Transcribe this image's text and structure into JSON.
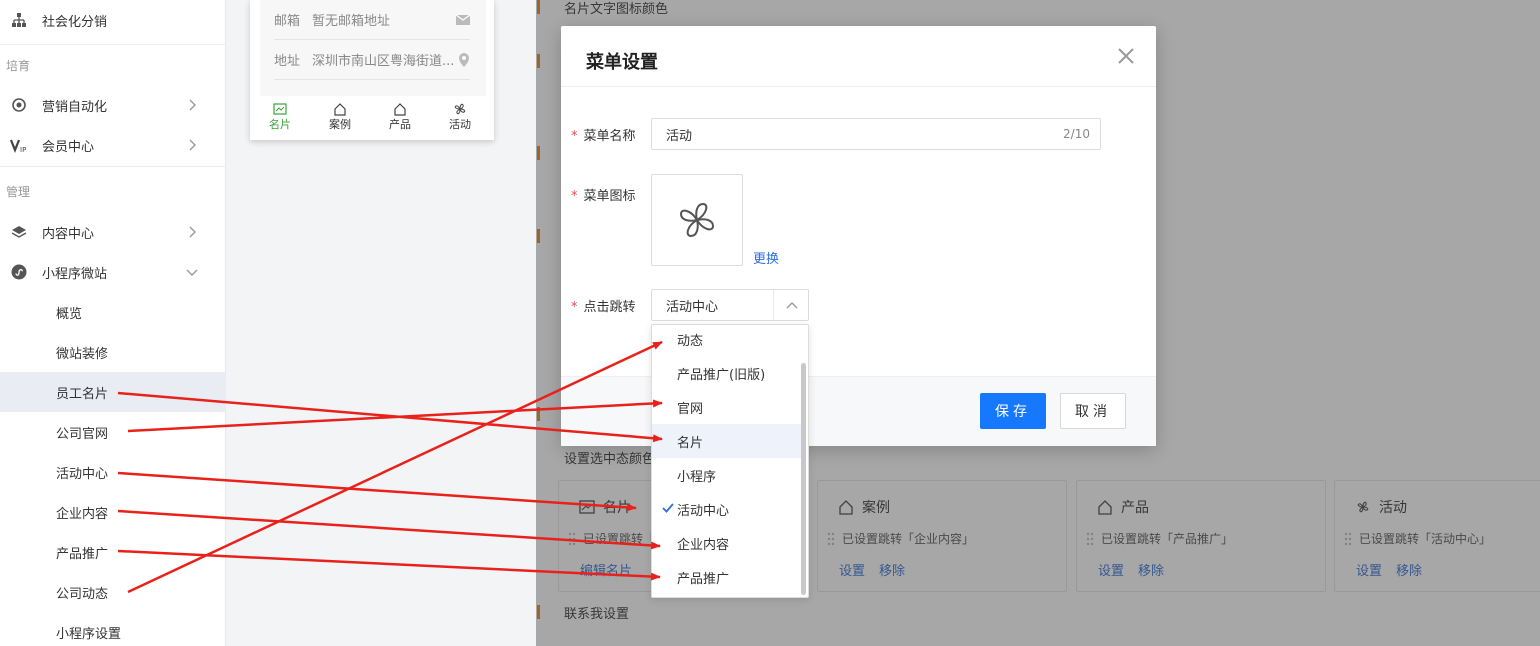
{
  "sidebar": {
    "top_item": "社会化分销",
    "section_cultivate": "培育",
    "marketing_automation": "营销自动化",
    "member_center": "会员中心",
    "section_manage": "管理",
    "content_center": "内容中心",
    "mini_program": "小程序微站",
    "sub_items": [
      "概览",
      "微站装修",
      "员工名片",
      "公司官网",
      "活动中心",
      "企业内容",
      "产品推广",
      "公司动态",
      "小程序设置"
    ]
  },
  "phone": {
    "email_label": "邮箱",
    "email_value": "暂无邮箱地址",
    "address_label": "地址",
    "address_value": "深圳市南山区粤海街道...",
    "tabs": [
      "名片",
      "案例",
      "产品",
      "活动"
    ]
  },
  "page": {
    "icon_color_label": "名片文字图标颜色",
    "selected_color_label": "设置选中态颜色",
    "contact_settings": "联系我设置"
  },
  "menu_cards": [
    {
      "title": "名片",
      "status": "已设置跳转「",
      "actions": [
        "编辑名片"
      ]
    },
    {
      "title": "案例",
      "status": "已设置跳转「企业内容」",
      "actions": [
        "设置",
        "移除"
      ]
    },
    {
      "title": "产品",
      "status": "已设置跳转「产品推广」",
      "actions": [
        "设置",
        "移除"
      ]
    },
    {
      "title": "活动",
      "status": "已设置跳转「活动中心」",
      "actions": [
        "设置",
        "移除"
      ]
    }
  ],
  "modal": {
    "title": "菜单设置",
    "name_label": "菜单名称",
    "name_value": "活动",
    "name_count": "2/10",
    "icon_label": "菜单图标",
    "replace": "更换",
    "jump_label": "点击跳转",
    "jump_value": "活动中心",
    "save": "保存",
    "cancel": "取消"
  },
  "dropdown": {
    "options": [
      "动态",
      "产品推广(旧版)",
      "官网",
      "名片",
      "小程序",
      "活动中心",
      "企业内容",
      "产品推广"
    ],
    "selected": "活动中心",
    "hovered": "名片"
  },
  "colors": {
    "primary": "#1677ff",
    "link": "#2f6fd6",
    "required": "#e5484d",
    "accent_bar": "#e88a1a",
    "arrow": "#e8221b"
  }
}
